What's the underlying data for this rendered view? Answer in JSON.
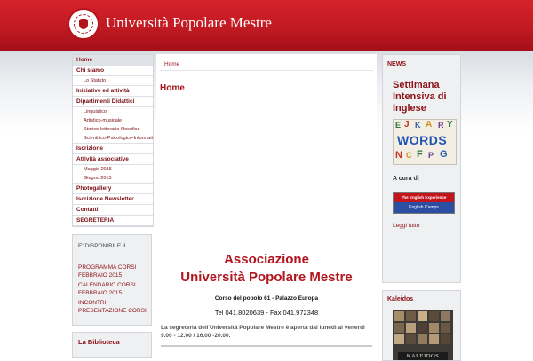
{
  "site": {
    "title": "Università Popolare Mestre"
  },
  "nav": {
    "items": [
      {
        "label": "Home",
        "active": true
      },
      {
        "label": "Chi siamo",
        "subs": [
          "Lo Statuto"
        ]
      },
      {
        "label": "Iniziative ed attività"
      },
      {
        "label": "Dipartimenti Didattici",
        "subs": [
          "Linguistico",
          "Artistico-musicale",
          "Storico-letterario-filosofico",
          "Scientifico-Psicologico-Informatico"
        ]
      },
      {
        "label": "Iscrizione"
      },
      {
        "label": "Attività associative",
        "subs": [
          "Maggio 2015",
          "Giugno 2015"
        ]
      },
      {
        "label": "Photogallery"
      },
      {
        "label": "Iscrizione Newsletter"
      },
      {
        "label": "Contatti"
      },
      {
        "label": "SEGRETERIA"
      }
    ]
  },
  "available": {
    "title": "E' DISPONIBILE IL",
    "links": [
      "PROGRAMMA CORSI FEBBRAIO 2015",
      "CALENDARIO CORSI FEBBRAIO 2015",
      "INCONTRI PRESENTAZIONE CORSI"
    ]
  },
  "library": {
    "title": "La Biblioteca"
  },
  "main": {
    "breadcrumb": "Home",
    "page_title": "Home",
    "assoc_line1": "Associazione",
    "assoc_line2": "Università Popolare Mestre",
    "address": "Corso del popolo 61 - Palazzo Europa",
    "phone": "Tel 041.8020639 - Fax  041.972348",
    "notice": "La segreteria dell'Università Popolare Mestre è aperta dal  lunedì al venerdì 9.00 - 12.00 / 16.00 -20.00."
  },
  "news": {
    "heading": "NEWS",
    "title": "Settimana Intensiva di Inglese",
    "image_words": "WORDS",
    "by": "A cura di",
    "banner_top": "The English Experience",
    "banner_bottom": "English Camps",
    "read_all": "Leggi tutto"
  },
  "kaleidos": {
    "heading": "Kaleidos",
    "image_label": "KALEIDOS"
  },
  "colors": {
    "brand_red": "#c11a22",
    "link": "#8c0f15",
    "panel": "#eef0f2"
  }
}
